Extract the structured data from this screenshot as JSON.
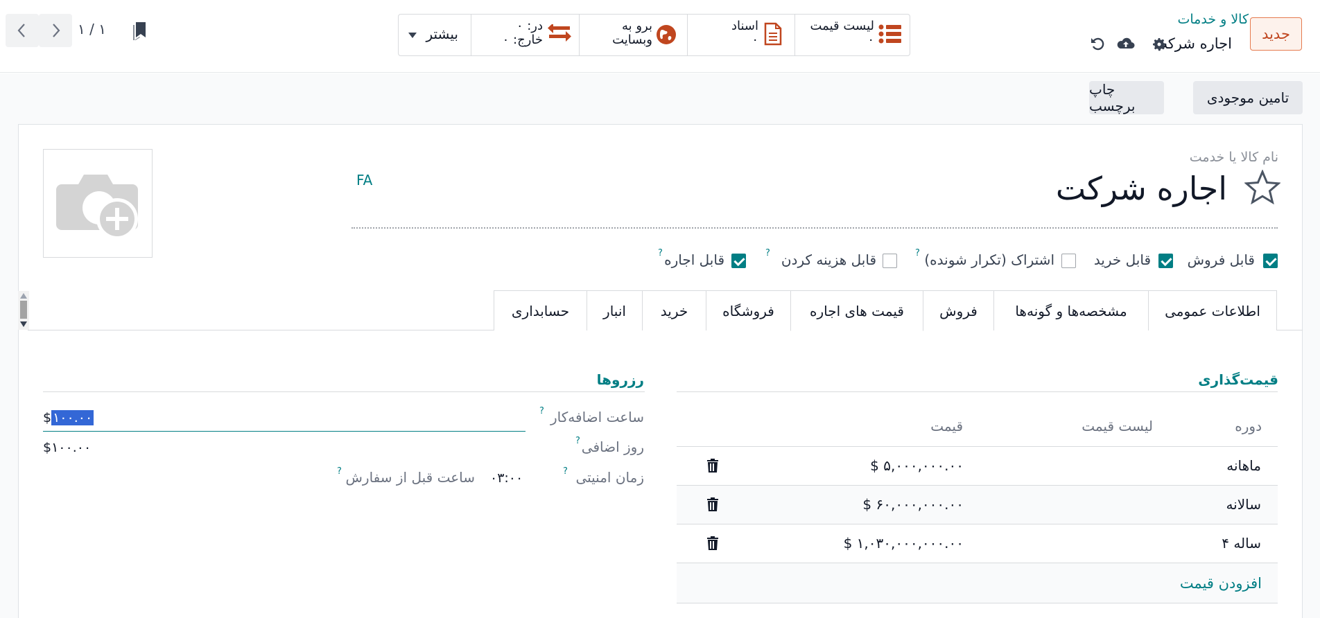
{
  "control_panel": {
    "new_button": "جدید",
    "breadcrumb_parent": "کالا و خدمات",
    "breadcrumb_current": "اجاره شرکت",
    "smart_buttons": {
      "pricelist_label": "لیست قیمت",
      "pricelist_count": "۰",
      "documents_label": "اسناد",
      "documents_count": "۰",
      "website_label_1": "برو به",
      "website_label_2": "وبسایت",
      "in_label": "در: ۰",
      "out_label": "خارج: ۰",
      "more_label": "بیشتر"
    },
    "pager_value": "۱ / ۱"
  },
  "status_bar": {
    "replenish_label": "تامین موجودی",
    "print_labels_label": "چاپ برچسب"
  },
  "form": {
    "name_label": "نام کالا یا خدمت",
    "product_name": "اجاره شرکت",
    "lang_badge": "FA",
    "checkboxes": [
      {
        "label": "قابل فروش",
        "checked": true
      },
      {
        "label": "قابل خرید",
        "checked": true
      },
      {
        "label": "اشتراک (تکرار شونده)",
        "checked": false
      },
      {
        "label": "قابل هزینه کردن",
        "checked": false
      },
      {
        "label": "قابل اجاره",
        "checked": true
      }
    ],
    "help_mark": "?"
  },
  "tabs": [
    {
      "label": "اطلاعات عمومی",
      "active": false
    },
    {
      "label": "مشخصه‌ها و گونه‌ها",
      "active": false
    },
    {
      "label": "فروش",
      "active": false
    },
    {
      "label": "قیمت های اجاره",
      "active": true
    },
    {
      "label": "فروشگاه",
      "active": false
    },
    {
      "label": "خرید",
      "active": false
    },
    {
      "label": "انبار",
      "active": false
    },
    {
      "label": "حسابداری",
      "active": false
    }
  ],
  "pricing": {
    "title": "قیمت‌گذاری",
    "headers": {
      "period": "دوره",
      "pricelist": "لیست قیمت",
      "price": "قیمت"
    },
    "rows": [
      {
        "period": "ماهانه",
        "pricelist": "",
        "price": "$ ۵,۰۰۰,۰۰۰.۰۰"
      },
      {
        "period": "سالانه",
        "pricelist": "",
        "price": "$ ۶۰,۰۰۰,۰۰۰.۰۰"
      },
      {
        "period": "۴ ساله",
        "pricelist": "",
        "price": "$ ۱,۰۳۰,۰۰۰,۰۰۰.۰۰"
      }
    ],
    "add_price": "افزودن قیمت"
  },
  "reservations": {
    "title": "رزروها",
    "extra_hour_label": "ساعت اضافه‌کار",
    "extra_hour_currency": "$",
    "extra_hour_value": "۱۰۰.۰۰",
    "extra_day_label": "روز اضافی",
    "extra_day_value": "$۱۰۰.۰۰",
    "security_time_label": "زمان امنیتی",
    "security_time_value": "۰۳:۰۰",
    "security_time_unit": "ساعت قبل از سفارش"
  },
  "colors": {
    "accent": "#017e84",
    "new_button": "#c0461f",
    "smart_icon": "#c0461f"
  },
  "icons": [
    "gear-icon",
    "cloud-upload-icon",
    "undo-icon",
    "list-icon",
    "document-icon",
    "globe-icon",
    "transfer-icon",
    "bookmark-icon",
    "star-icon",
    "camera-plus-icon",
    "trash-icon",
    "chevron-left-icon",
    "chevron-right-icon"
  ]
}
